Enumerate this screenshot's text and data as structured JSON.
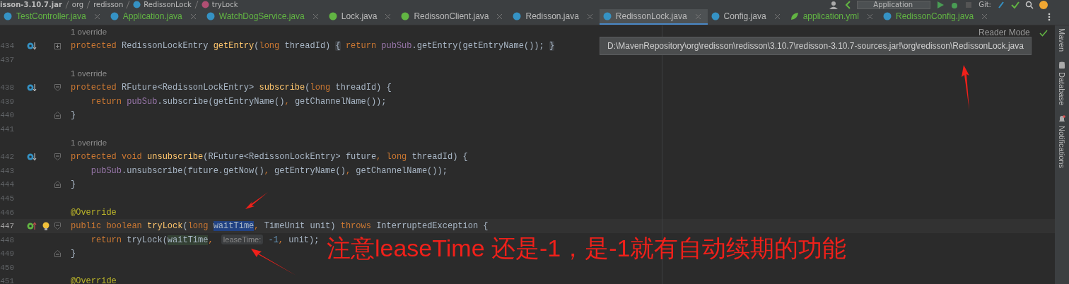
{
  "breadcrumbs": [
    {
      "label": "isson-3.10.7.jar",
      "kind": "jar"
    },
    {
      "label": "org",
      "kind": "package"
    },
    {
      "label": "redisson",
      "kind": "package"
    },
    {
      "label": "RedissonLock",
      "kind": "class"
    },
    {
      "label": "tryLock",
      "kind": "method"
    }
  ],
  "toolbar": {
    "run_config": "Application",
    "vcs_label": "Git:"
  },
  "tabs": [
    {
      "label": "TestController.java",
      "kind": "class",
      "color": "#62b543",
      "selected": false
    },
    {
      "label": "Application.java",
      "kind": "spring",
      "color": "#62b543",
      "selected": false
    },
    {
      "label": "WatchDogService.java",
      "kind": "class",
      "color": "#62b543",
      "selected": false
    },
    {
      "label": "Lock.java",
      "kind": "interface",
      "color": "#bbbbbb",
      "selected": false
    },
    {
      "label": "RedissonClient.java",
      "kind": "interface",
      "color": "#bbbbbb",
      "selected": false
    },
    {
      "label": "Redisson.java",
      "kind": "class",
      "color": "#bbbbbb",
      "selected": false
    },
    {
      "label": "RedissonLock.java",
      "kind": "class",
      "color": "#bbbbbb",
      "selected": true
    },
    {
      "label": "Config.java",
      "kind": "class",
      "color": "#bbbbbb",
      "selected": false
    },
    {
      "label": "application.yml",
      "kind": "yml",
      "color": "#62b543",
      "selected": false
    },
    {
      "label": "RedissonConfig.java",
      "kind": "class",
      "color": "#62b543",
      "selected": false
    }
  ],
  "editor": {
    "reader_mode": "Reader Mode",
    "lines": [
      {
        "kind": "inlay",
        "text": "1 override"
      },
      {
        "kind": "code",
        "number": "434",
        "gutter_icon": {
          "kind": "overridden"
        },
        "fold_marker": {
          "kind": "collapsed"
        },
        "tokens": [
          {
            "kind": "kw",
            "text": "protected "
          },
          {
            "kind": "plain",
            "text": "RedissonLockEntry "
          },
          {
            "kind": "fn",
            "text": "getEntry"
          },
          {
            "kind": "plain",
            "text": "("
          },
          {
            "kind": "kw",
            "text": "long "
          },
          {
            "kind": "plain",
            "text": "threadId) "
          },
          {
            "kind": "fold",
            "text": "{"
          },
          {
            "kind": "kw",
            "text": " return "
          },
          {
            "kind": "field",
            "text": "pubSub"
          },
          {
            "kind": "plain",
            "text": ".getEntry(getEntryName()); "
          },
          {
            "kind": "fold",
            "text": "}"
          }
        ]
      },
      {
        "kind": "code",
        "number": "437"
      },
      {
        "kind": "inlay",
        "text": "1 override"
      },
      {
        "kind": "code",
        "number": "438",
        "gutter_icon": {
          "kind": "overridden"
        },
        "fold_marker": {
          "kind": "start"
        },
        "tokens": [
          {
            "kind": "kw",
            "text": "protected "
          },
          {
            "kind": "plain",
            "text": "RFuture<RedissonLockEntry> "
          },
          {
            "kind": "fn",
            "text": "subscribe"
          },
          {
            "kind": "plain",
            "text": "("
          },
          {
            "kind": "kw",
            "text": "long "
          },
          {
            "kind": "plain",
            "text": "threadId) {"
          }
        ]
      },
      {
        "kind": "code",
        "number": "439",
        "indented": true,
        "tokens": [
          {
            "kind": "kw",
            "text": "return "
          },
          {
            "kind": "field",
            "text": "pubSub"
          },
          {
            "kind": "plain",
            "text": ".subscribe(getEntryName()"
          },
          {
            "kind": "kw",
            "text": ", "
          },
          {
            "kind": "plain",
            "text": "getChannelName());"
          }
        ]
      },
      {
        "kind": "code",
        "number": "440",
        "fold_marker": {
          "kind": "end"
        },
        "tokens": [
          {
            "kind": "plain",
            "text": "}"
          }
        ]
      },
      {
        "kind": "code",
        "number": "441"
      },
      {
        "kind": "inlay",
        "text": "1 override"
      },
      {
        "kind": "code",
        "number": "442",
        "gutter_icon": {
          "kind": "overridden"
        },
        "fold_marker": {
          "kind": "start"
        },
        "tokens": [
          {
            "kind": "kw",
            "text": "protected void "
          },
          {
            "kind": "fn",
            "text": "unsubscribe"
          },
          {
            "kind": "plain",
            "text": "(RFuture<RedissonLockEntry> future"
          },
          {
            "kind": "kw",
            "text": ", long "
          },
          {
            "kind": "plain",
            "text": "threadId) {"
          }
        ]
      },
      {
        "kind": "code",
        "number": "443",
        "indented": true,
        "tokens": [
          {
            "kind": "field",
            "text": "pubSub"
          },
          {
            "kind": "plain",
            "text": ".unsubscribe(future.getNow()"
          },
          {
            "kind": "kw",
            "text": ", "
          },
          {
            "kind": "plain",
            "text": "getEntryName()"
          },
          {
            "kind": "kw",
            "text": ", "
          },
          {
            "kind": "plain",
            "text": "getChannelName());"
          }
        ]
      },
      {
        "kind": "code",
        "number": "444",
        "fold_marker": {
          "kind": "end"
        },
        "tokens": [
          {
            "kind": "plain",
            "text": "}"
          }
        ]
      },
      {
        "kind": "code",
        "number": "445"
      },
      {
        "kind": "code",
        "number": "446",
        "tokens": [
          {
            "kind": "ann",
            "text": "@Override"
          }
        ]
      },
      {
        "kind": "code",
        "number": "447",
        "gutter_icon": {
          "kind": "implements"
        },
        "fold_marker": {
          "kind": "start"
        },
        "bulb": true,
        "current": true,
        "tokens": [
          {
            "kind": "kw",
            "text": "public boolean "
          },
          {
            "kind": "fn",
            "text": "tryLock"
          },
          {
            "kind": "plain",
            "text": "("
          },
          {
            "kind": "kw",
            "text": "long "
          },
          {
            "kind": "sel",
            "text": "waitTime"
          },
          {
            "kind": "kw",
            "text": ", "
          },
          {
            "kind": "plain",
            "text": "TimeUnit unit) "
          },
          {
            "kind": "kw",
            "text": "throws "
          },
          {
            "kind": "plain",
            "text": "InterruptedException {"
          }
        ]
      },
      {
        "kind": "code",
        "number": "448",
        "indented": true,
        "tokens": [
          {
            "kind": "kw",
            "text": "return "
          },
          {
            "kind": "plain",
            "text": "tryLock("
          },
          {
            "kind": "match",
            "text": "waitTime"
          },
          {
            "kind": "kw",
            "text": ", "
          },
          {
            "kind": "hint",
            "text": "leaseTime:"
          },
          {
            "kind": "num",
            "text": " -1"
          },
          {
            "kind": "kw",
            "text": ", "
          },
          {
            "kind": "plain",
            "text": "unit);"
          }
        ]
      },
      {
        "kind": "code",
        "number": "449",
        "fold_marker": {
          "kind": "end"
        },
        "tokens": [
          {
            "kind": "plain",
            "text": "}"
          }
        ]
      },
      {
        "kind": "code",
        "number": "450"
      },
      {
        "kind": "code",
        "number": "451",
        "tokens": [
          {
            "kind": "ann",
            "text": "@Override"
          }
        ]
      }
    ]
  },
  "tooltip": "D:\\MavenRepository\\org\\redisson\\redisson\\3.10.7\\redisson-3.10.7-sources.jar!\\org\\redisson\\RedissonLock.java",
  "annotation": "注意leaseTime 还是-1，是-1就有自动续期的功能",
  "side_tools": [
    "Maven",
    "Database",
    "Notifications"
  ]
}
